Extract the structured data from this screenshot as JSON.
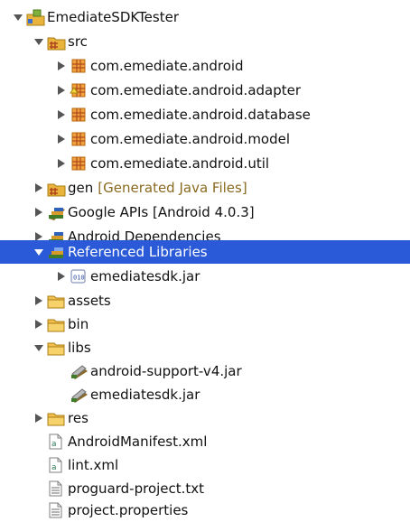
{
  "tree": {
    "project": "EmediateSDKTester",
    "src": "src",
    "packages": [
      "com.emediate.android",
      "com.emediate.android.adapter",
      "com.emediate.android.database",
      "com.emediate.android.model",
      "com.emediate.android.util"
    ],
    "gen": "gen",
    "gen_decoration": "[Generated Java Files]",
    "google_apis": "Google APIs [Android 4.0.3]",
    "android_dependencies": "Android Dependencies",
    "referenced_libraries": "Referenced Libraries",
    "referenced_jar": "emediatesdk.jar",
    "assets": "assets",
    "bin": "bin",
    "libs": "libs",
    "libs_items": [
      "android-support-v4.jar",
      "emediatesdk.jar"
    ],
    "res": "res",
    "files": [
      "AndroidManifest.xml",
      "lint.xml",
      "proguard-project.txt",
      "project.properties"
    ]
  },
  "colors": {
    "selection": "#2a5ad7",
    "decoration": "#8a6a1f",
    "folder": "#e9b33c",
    "package": "#d98a1c"
  }
}
